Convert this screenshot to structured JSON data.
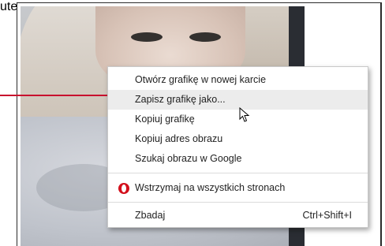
{
  "photo": {
    "vertical_text": "ute"
  },
  "context_menu": {
    "items": [
      {
        "label": "Otwórz grafikę w nowej karcie"
      },
      {
        "label": "Zapisz grafikę jako..."
      },
      {
        "label": "Kopiuj grafikę"
      },
      {
        "label": "Kopiuj adres obrazu"
      },
      {
        "label": "Szukaj obrazu w Google"
      },
      {
        "label": "Wstrzymaj na wszystkich stronach",
        "icon": "opera-icon"
      },
      {
        "label": "Zbadaj",
        "shortcut": "Ctrl+Shift+I"
      }
    ],
    "highlighted_index": 1
  },
  "colors": {
    "accent": "#c8102e",
    "opera": "#d3101c",
    "menu_highlight": "#ececec"
  }
}
